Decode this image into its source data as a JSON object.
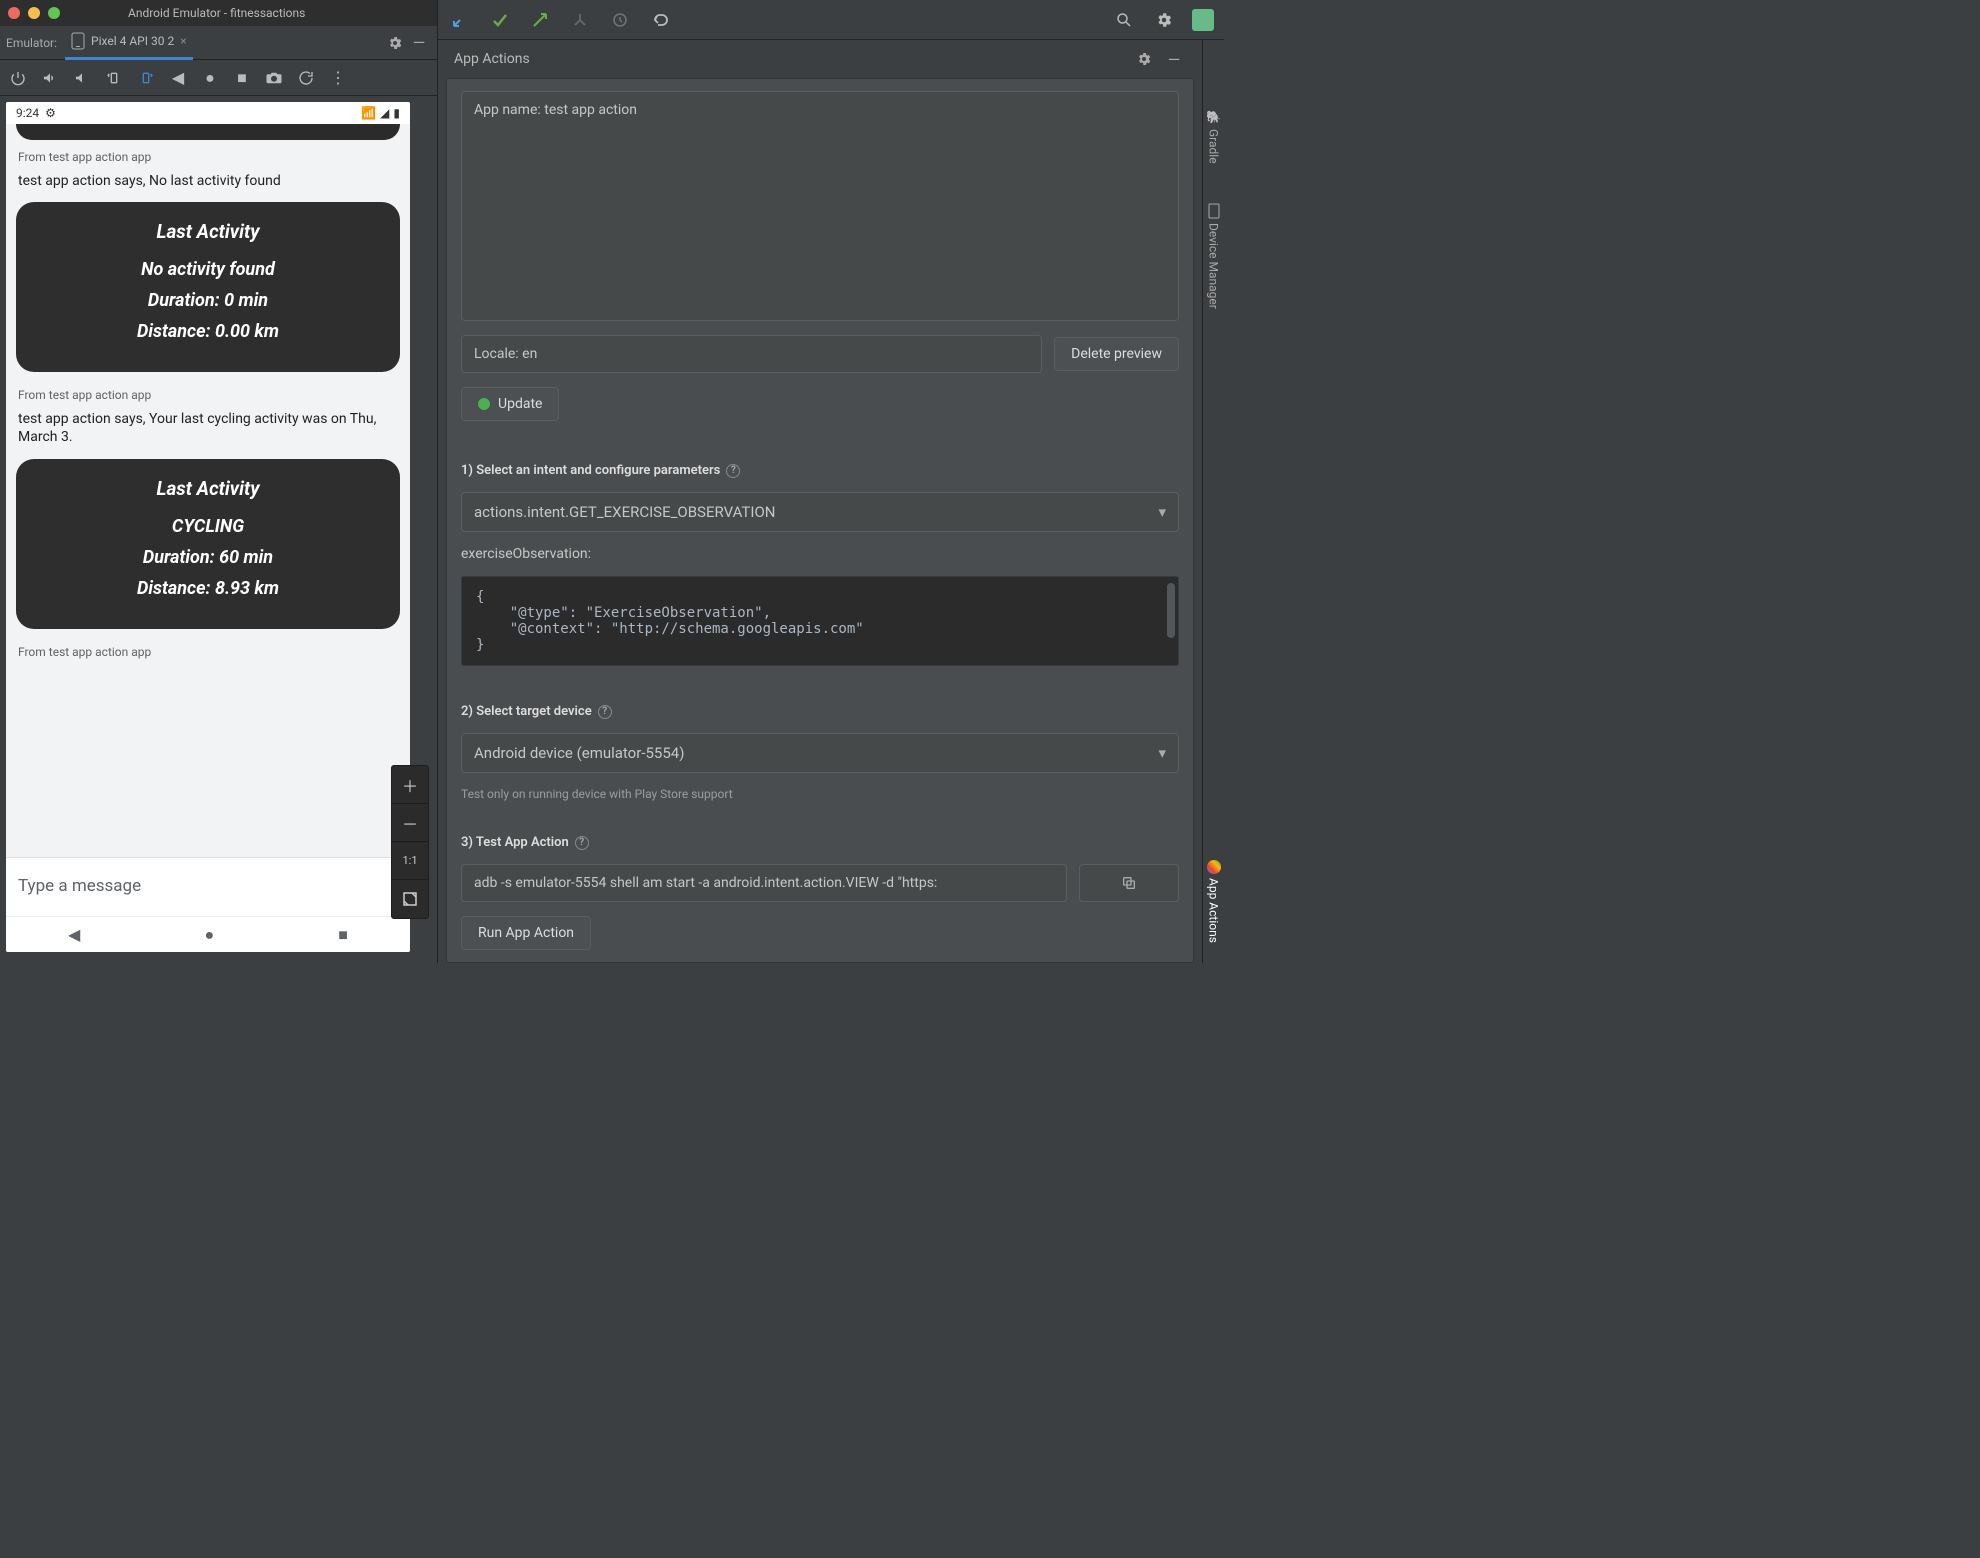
{
  "window": {
    "title": "Android Emulator - fitnessactions"
  },
  "emulator": {
    "label": "Emulator:",
    "tab": "Pixel 4 API 30 2"
  },
  "android": {
    "status_time": "9:24",
    "from_label": "From test app action app",
    "says1": "test app action says, No last activity found",
    "says2": "test app action says, Your last cycling activity was on Thu, March 3.",
    "card1": {
      "title": "Last Activity",
      "l1": "No activity found",
      "l2": "Duration: 0 min",
      "l3": "Distance: 0.00 km"
    },
    "card2": {
      "title": "Last Activity",
      "l1": "CYCLING",
      "l2": "Duration: 60 min",
      "l3": "Distance: 8.93 km"
    },
    "input_placeholder": "Type a message",
    "zoom_ratio": "1:1"
  },
  "app_actions": {
    "panel_title": "App Actions",
    "app_name_field": "App name: test app action",
    "locale_field": "Locale: en",
    "delete_preview_btn": "Delete preview",
    "update_btn": "Update",
    "step1_label": "1) Select an intent and configure parameters",
    "intent_value": "actions.intent.GET_EXERCISE_OBSERVATION",
    "param_label": "exerciseObservation:",
    "code": "{\n    \"@type\": \"ExerciseObservation\",\n    \"@context\": \"http://schema.googleapis.com\"\n}",
    "step2_label": "2) Select target device",
    "device_value": "Android device (emulator-5554)",
    "device_hint": "Test only on running device with Play Store support",
    "step3_label": "3) Test App Action",
    "adb_cmd": "adb -s emulator-5554 shell am start -a android.intent.action.VIEW -d \"https:",
    "run_btn": "Run App Action"
  },
  "side": {
    "gradle": "Gradle",
    "device_manager": "Device Manager",
    "app_actions": "App Actions"
  }
}
